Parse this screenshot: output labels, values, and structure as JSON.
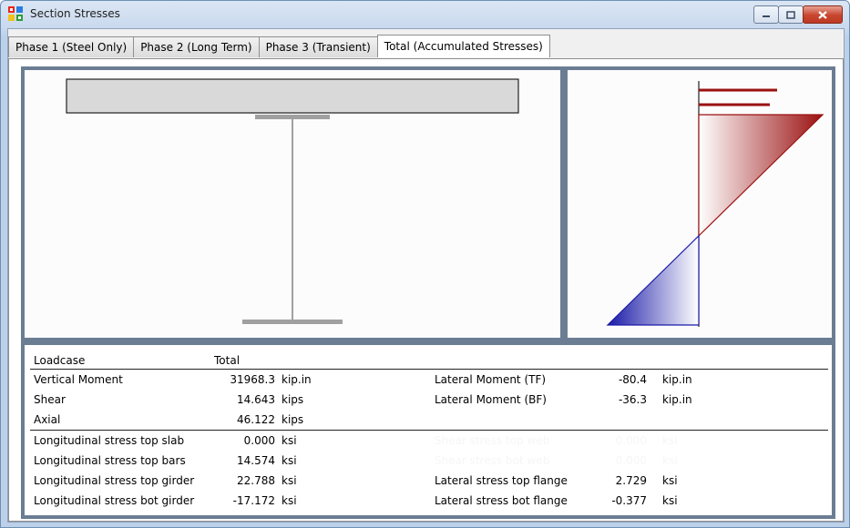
{
  "window": {
    "title": "Section Stresses",
    "icons": {
      "app": "section-stresses-app-icon",
      "minimize": "minimize-icon",
      "maximize": "maximize-icon",
      "close": "close-icon"
    }
  },
  "tabs": [
    {
      "label": "Phase 1 (Steel Only)",
      "active": false
    },
    {
      "label": "Phase 2 (Long Term)",
      "active": false
    },
    {
      "label": "Phase 3 (Transient)",
      "active": false
    },
    {
      "label": "Total (Accumulated Stresses)",
      "active": true
    }
  ],
  "colors": {
    "tension": "#9b1111",
    "compression": "#1a1aa8",
    "steel": "#a0a0a0",
    "slab_fill": "#d9d9d9",
    "frame": "#6b7d93"
  },
  "table": {
    "header": {
      "label": "Loadcase",
      "value": "Total"
    },
    "rows": [
      {
        "label": "Vertical Moment",
        "value": "31968.3",
        "unit": "kip.in",
        "label2": "Lateral Moment (TF)",
        "value2": "-80.4",
        "unit2": "kip.in"
      },
      {
        "label": "Shear",
        "value": "14.643",
        "unit": "kips",
        "label2": "Lateral Moment (BF)",
        "value2": "-36.3",
        "unit2": "kip.in"
      },
      {
        "label": "Axial",
        "value": "46.122",
        "unit": "kips",
        "label2": "",
        "value2": "",
        "unit2": ""
      },
      {
        "label": "Longitudinal stress top slab",
        "value": "0.000",
        "unit": "ksi",
        "label2": "Shear stress top web",
        "value2": "0.000",
        "unit2": "ksi"
      },
      {
        "label": "Longitudinal stress top bars",
        "value": "14.574",
        "unit": "ksi",
        "label2": "Shear stress bot web",
        "value2": "0.000",
        "unit2": "ksi"
      },
      {
        "label": "Longitudinal stress top girder",
        "value": "22.788",
        "unit": "ksi",
        "label2": "Lateral stress top flange",
        "value2": "2.729",
        "unit2": "ksi"
      },
      {
        "label": "Longitudinal stress bot girder",
        "value": "-17.172",
        "unit": "ksi",
        "label2": "Lateral stress bot flange",
        "value2": "-0.377",
        "unit2": "ksi"
      }
    ]
  }
}
